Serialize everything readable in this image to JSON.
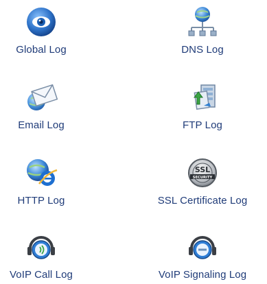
{
  "tiles": [
    {
      "id": "global",
      "label": "Global Log",
      "icon": "eye-globe-icon"
    },
    {
      "id": "dns",
      "label": "DNS Log",
      "icon": "network-globe-icon"
    },
    {
      "id": "email",
      "label": "Email Log",
      "icon": "envelope-globe-icon"
    },
    {
      "id": "ftp",
      "label": "FTP Log",
      "icon": "ftp-server-icon"
    },
    {
      "id": "http",
      "label": "HTTP Log",
      "icon": "ie-globe-icon"
    },
    {
      "id": "ssl",
      "label": "SSL Certificate Log",
      "icon": "ssl-security-badge-icon"
    },
    {
      "id": "voip_call",
      "label": "VoIP Call Log",
      "icon": "headset-call-icon"
    },
    {
      "id": "voip_signaling",
      "label": "VoIP Signaling Log",
      "icon": "headset-signaling-icon"
    }
  ],
  "colors": {
    "label": "#1f3b78",
    "globe_blue": "#3a86d6",
    "eye_blue": "#1a5fb4"
  }
}
